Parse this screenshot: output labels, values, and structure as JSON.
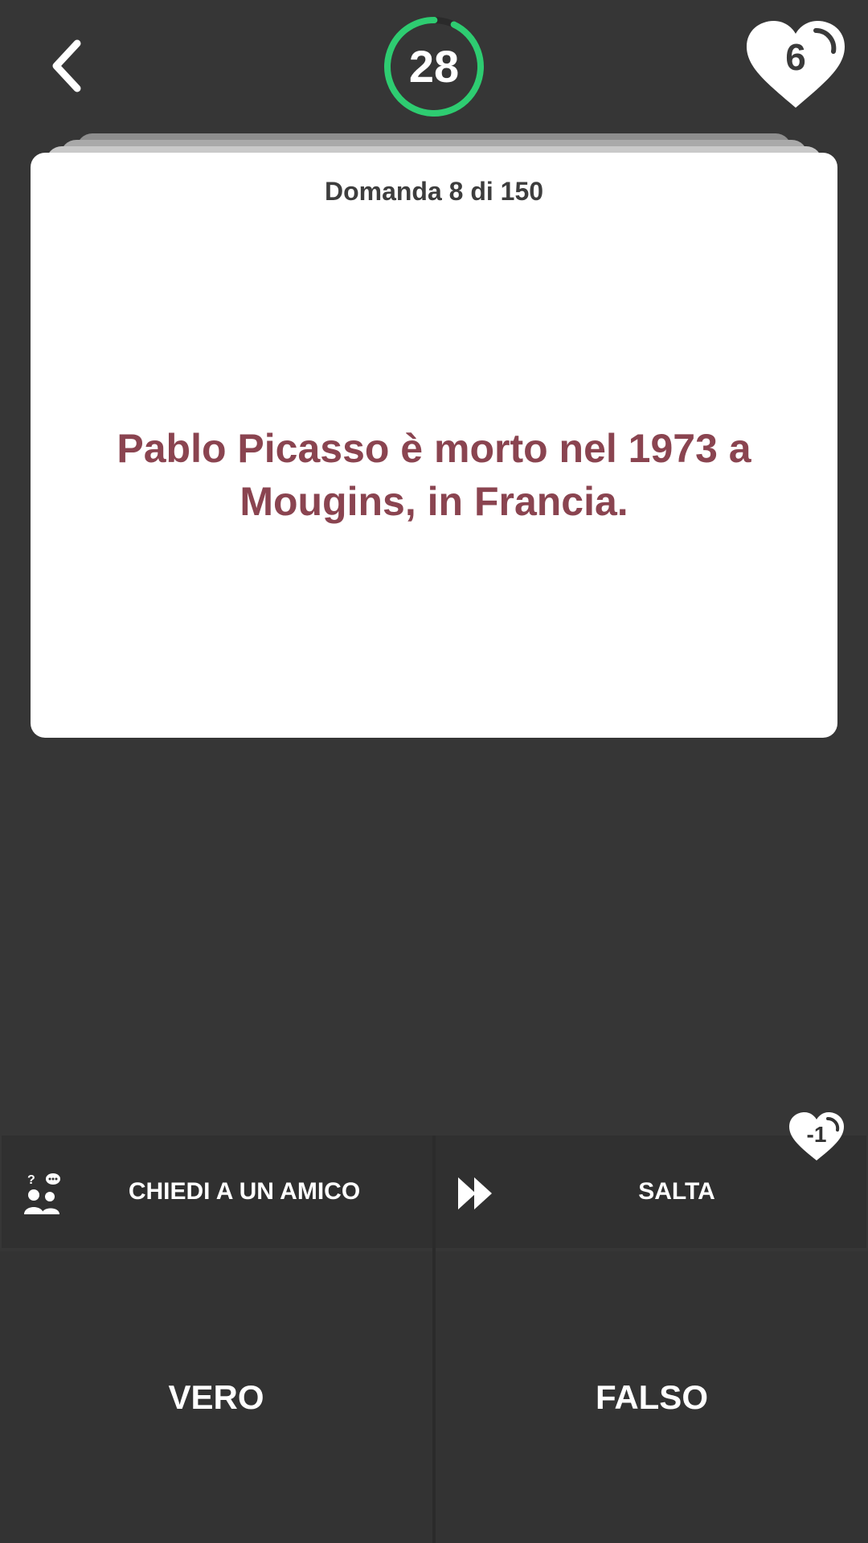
{
  "header": {
    "back_icon": "chevron-left-icon",
    "timer_value": "28",
    "timer_progress": 0.93,
    "timer_color": "#2ecc71",
    "lives_count": "6",
    "lives_icon": "heart-icon"
  },
  "card": {
    "counter": "Domanda 8 di 150",
    "question": "Pablo Picasso è morto nel 1973 a Mougins, in Francia.",
    "question_color": "#8a4450"
  },
  "actions": {
    "ask_friend_label": "CHIEDI A UN AMICO",
    "ask_friend_icon": "ask-friend-icon",
    "skip_label": "SALTA",
    "skip_icon": "fast-forward-icon",
    "skip_cost": "-1"
  },
  "answers": {
    "true_label": "VERO",
    "false_label": "FALSO"
  }
}
